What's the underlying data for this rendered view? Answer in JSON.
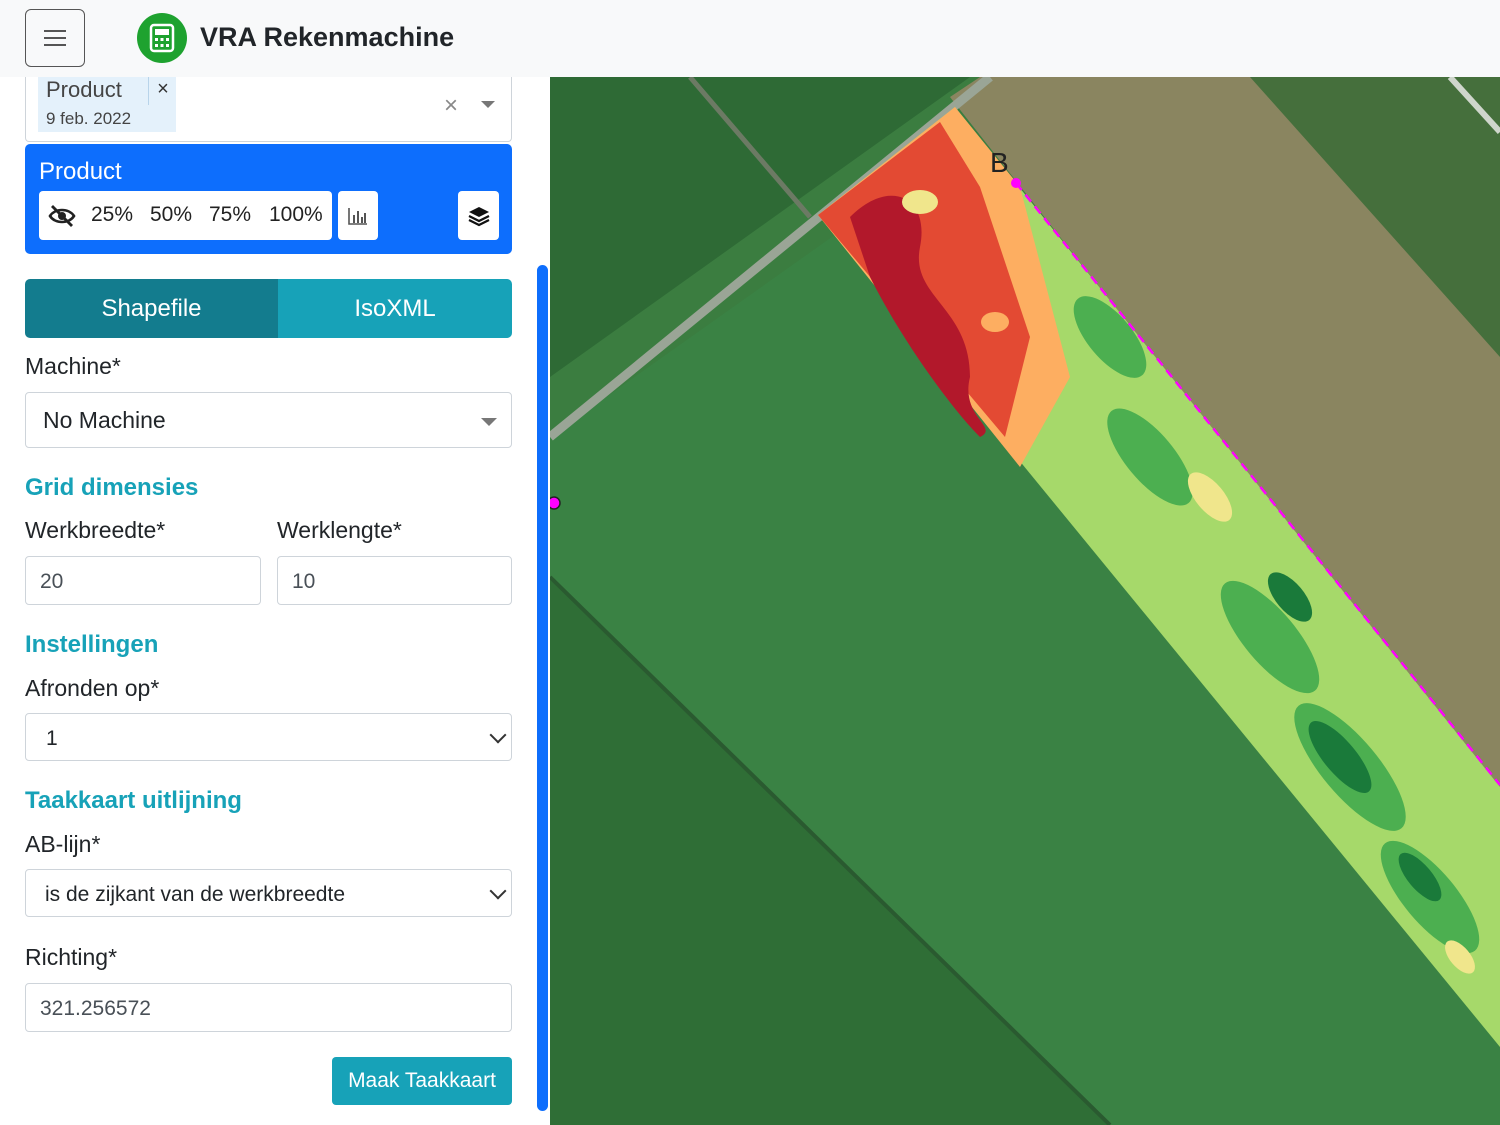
{
  "header": {
    "menu_icon": "hamburger-icon",
    "logo_icon": "calculator-icon",
    "title": "VRA Rekenmachine"
  },
  "layer_select": {
    "chip_name": "Product",
    "chip_date": "9 feb. 2022",
    "chip_remove": "×",
    "clear": "×"
  },
  "product_card": {
    "title": "Product",
    "opacity_options": [
      "25%",
      "50%",
      "75%",
      "100%"
    ],
    "hide_icon": "eye-slash-icon",
    "chart_icon": "bar-chart-icon",
    "layers_icon": "layers-icon"
  },
  "export_tabs": {
    "active": "Shapefile",
    "inactive": "IsoXML"
  },
  "form": {
    "machine_label": "Machine*",
    "machine_value": "No Machine",
    "grid_heading": "Grid dimensies",
    "width_label": "Werkbreedte*",
    "width_value": "20",
    "length_label": "Werklengte*",
    "length_value": "10",
    "settings_heading": "Instellingen",
    "round_label": "Afronden op*",
    "round_value": "1",
    "align_heading": "Taakkaart uitlijning",
    "ab_label": "AB-lijn*",
    "ab_value": "is de zijkant van de werkbreedte",
    "direction_label": "Richting*",
    "direction_value": "321.256572",
    "submit": "Maak Taakkaart"
  },
  "map": {
    "point_label": "B",
    "colors": {
      "field_dark": "#2f6b35",
      "field_mid": "#3d8446",
      "road": "#8a9a88",
      "red_dark": "#b2182b",
      "red": "#e34a33",
      "orange": "#fdae61",
      "yellow": "#f0e68c",
      "light_green": "#a6d96a",
      "green": "#4caf50",
      "dark_green": "#1a7a3a",
      "ab_line": "#ff00ff"
    }
  }
}
